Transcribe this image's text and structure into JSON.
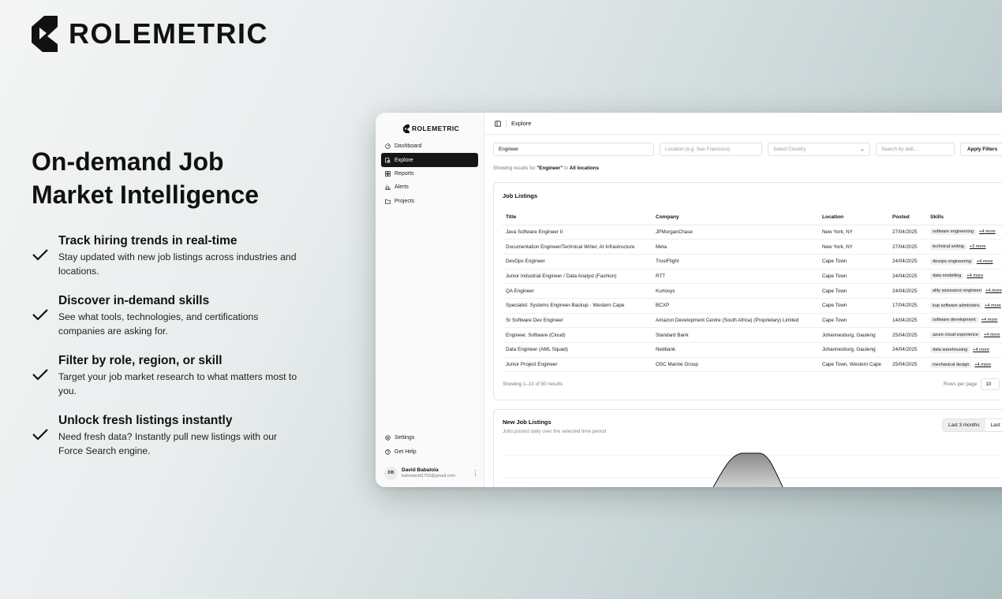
{
  "brand": {
    "name": "ROLEMETRIC"
  },
  "hero": {
    "line1": "On-demand Job",
    "line2": "Market Intelligence"
  },
  "features": [
    {
      "title": "Track hiring trends in real-time",
      "desc": "Stay updated with new job listings across industries and locations."
    },
    {
      "title": "Discover in-demand skills",
      "desc": "See what tools, technologies, and certifications companies are asking for."
    },
    {
      "title": "Filter by role, region, or skill",
      "desc": "Target your job market research to what matters most to you."
    },
    {
      "title": "Unlock fresh listings instantly",
      "desc": "Need fresh data? Instantly pull new listings with our Force Search engine."
    }
  ],
  "app": {
    "sidebar": {
      "logo": "ROLEMETRIC",
      "nav": [
        {
          "label": "Dashboard",
          "icon": "dashboard-icon"
        },
        {
          "label": "Explore",
          "icon": "explore-icon",
          "active": true
        },
        {
          "label": "Reports",
          "icon": "reports-icon"
        },
        {
          "label": "Alerts",
          "icon": "alerts-icon"
        },
        {
          "label": "Projects",
          "icon": "folder-icon"
        }
      ],
      "bottom": [
        {
          "label": "Settings",
          "icon": "gear-icon"
        },
        {
          "label": "Get Help",
          "icon": "help-icon"
        }
      ],
      "user": {
        "initials": "DB",
        "name": "David Babalola",
        "email": "babsdavid1703@gmail.com"
      }
    },
    "topbar": {
      "crumb": "Explore"
    },
    "filters": {
      "query": "Engineer",
      "location_placeholder": "Location (e.g. San Francisco)",
      "country_placeholder": "Select Country",
      "skill_placeholder": "Search by skill...",
      "apply": "Apply Filters"
    },
    "results": {
      "prefix": "Showing results for",
      "query": "\"Engineer\"",
      "in": "in",
      "location": "All locations"
    },
    "listings": {
      "title": "Job Listings",
      "columns": [
        "Title",
        "Company",
        "Location",
        "Posted",
        "Skills"
      ],
      "rows": [
        {
          "title": "Java Software Engineer II",
          "company": "JPMorganChase",
          "location": "New York, NY",
          "posted": "27/04/2025",
          "skill": "software engineering",
          "more": "+4 more"
        },
        {
          "title": "Documentation Engineer/Technical Writer, AI Infrastructure",
          "company": "Meta",
          "location": "New York, NY",
          "posted": "27/04/2025",
          "skill": "technical writing",
          "more": "+3 more"
        },
        {
          "title": "DevOps Engineer",
          "company": "TrustFlight",
          "location": "Cape Town",
          "posted": "24/04/2025",
          "skill": "devops engineering",
          "more": "+4 more"
        },
        {
          "title": "Junior Industrial Engineer / Data Analyst (Fashion)",
          "company": "RTT",
          "location": "Cape Town",
          "posted": "24/04/2025",
          "skill": "data modelling",
          "more": "+4 more"
        },
        {
          "title": "QA Engineer",
          "company": "Kurtosys",
          "location": "Cape Town",
          "posted": "24/04/2025",
          "skill": "ality assurance engineeri",
          "more": "+4 more"
        },
        {
          "title": "Specialist: Systems Engineer-Backup - Western Cape",
          "company": "BCXP",
          "location": "Cape Town",
          "posted": "17/04/2025",
          "skill": "kup software administra",
          "more": "+4 more"
        },
        {
          "title": "Sr Software Dev Engineer",
          "company": "Amazon Development Centre (South Africa) (Proprietary) Limited",
          "location": "Cape Town",
          "posted": "14/04/2025",
          "skill": "software development",
          "more": "+4 more"
        },
        {
          "title": "Engineer, Software (Cloud)",
          "company": "Standard Bank",
          "location": "Johannesburg, Gauteng",
          "posted": "25/04/2025",
          "skill": "azure cloud experience",
          "more": "+4 more"
        },
        {
          "title": "Data Engineer (AML Squad)",
          "company": "Nedbank",
          "location": "Johannesburg, Gauteng",
          "posted": "24/04/2025",
          "skill": "data warehousing",
          "more": "+4 more"
        },
        {
          "title": "Junior Project Engineer",
          "company": "OSC Marine Group",
          "location": "Cape Town, Western Cape",
          "posted": "25/04/2025",
          "skill": "mechanical design",
          "more": "+4 more"
        }
      ],
      "showing": "Showing 1–10 of 50 results",
      "rows_per_page_label": "Rows per page",
      "rows_per_page": "10"
    },
    "new_jobs": {
      "title": "New Job Listings",
      "subtitle": "Jobs posted daily over the selected time period",
      "ranges": [
        "Last 3 months",
        "Last"
      ]
    }
  }
}
